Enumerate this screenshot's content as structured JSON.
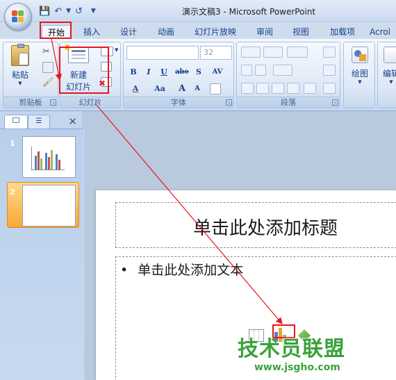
{
  "window": {
    "title": "演示文稿3 - Microsoft PowerPoint"
  },
  "quick_access": {
    "save_icon": "save-icon",
    "undo_icon": "undo-icon",
    "redo_icon": "redo-icon",
    "customize_icon": "dropdown-arrow-icon"
  },
  "tabs": [
    {
      "label": "开始",
      "active": true
    },
    {
      "label": "插入"
    },
    {
      "label": "设计"
    },
    {
      "label": "动画"
    },
    {
      "label": "幻灯片放映"
    },
    {
      "label": "审阅"
    },
    {
      "label": "视图"
    },
    {
      "label": "加载项"
    },
    {
      "label": "Acrol"
    }
  ],
  "ribbon": {
    "clipboard": {
      "paste_label": "粘贴",
      "group_label": "剪贴板"
    },
    "slides": {
      "new_slide_line1": "新建",
      "new_slide_line2": "幻灯片",
      "group_label": "幻灯片"
    },
    "font": {
      "font_name": "",
      "font_size": "32",
      "group_label": "字体",
      "buttons": [
        "B",
        "I",
        "U",
        "abe",
        "S",
        "AV",
        "A",
        "Aa",
        "A",
        "A"
      ]
    },
    "paragraph": {
      "group_label": "段落"
    },
    "drawing": {
      "draw_label": "绘图"
    },
    "editing": {
      "edit_label": "编辑"
    }
  },
  "slide_panel": {
    "slides": [
      {
        "number": "1"
      },
      {
        "number": "2",
        "selected": true
      }
    ]
  },
  "slide": {
    "title_placeholder": "单击此处添加标题",
    "body_bullet": "•",
    "body_placeholder": "单击此处添加文本"
  },
  "watermark": {
    "text": "技术员联盟",
    "url": "www.jsgho.com"
  },
  "colors": {
    "annotation": "#e8141c",
    "ribbon_text": "#15428b",
    "watermark": "#3aa23a"
  }
}
